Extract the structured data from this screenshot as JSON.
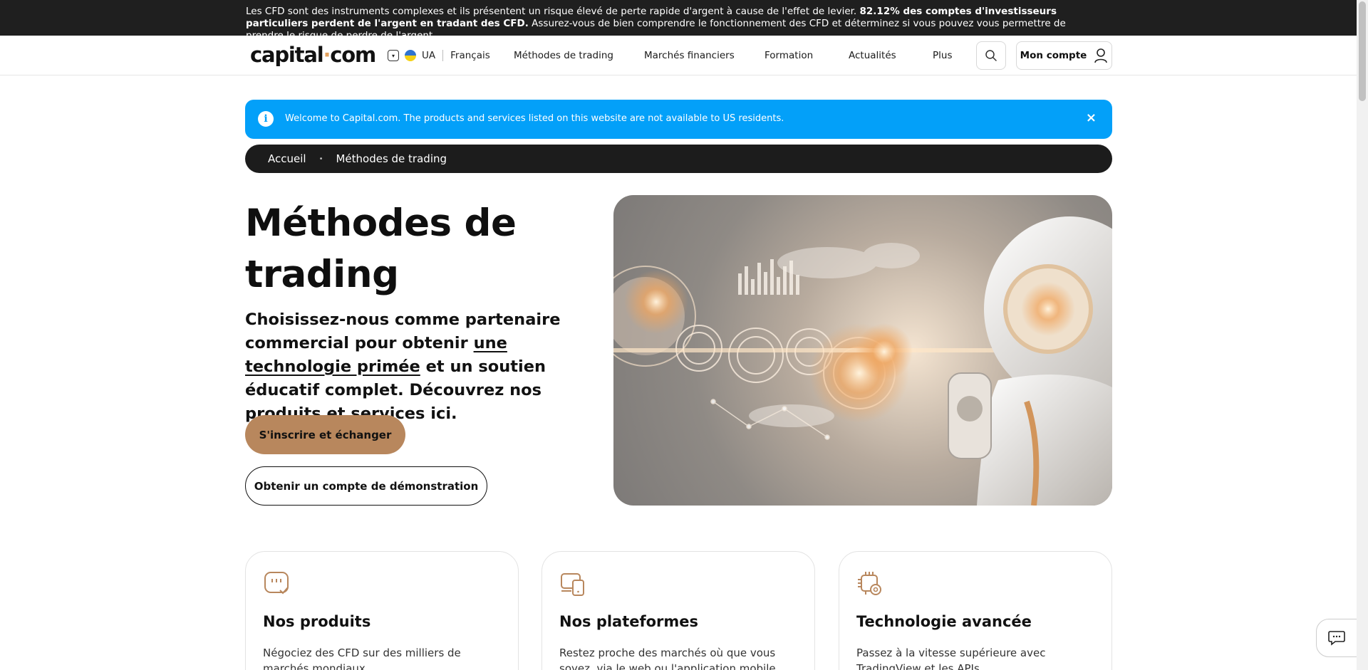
{
  "risk_banner": {
    "text_start": "Les CFD sont des instruments complexes et ils présentent un risque élevé de perte rapide d'argent à cause de l'effet de levier. ",
    "text_bold": "82.12% des comptes d'investisseurs particuliers perdent de l'argent en tradant des CFD.",
    "text_end": " Assurez-vous de bien comprendre le fonctionnement des CFD et déterminez si vous pouvez vous permettre de prendre le risque de perdre de l'argent."
  },
  "header": {
    "logo_part1": "capital",
    "logo_dot": "·",
    "logo_part2": "com",
    "country": "UA",
    "language": "Français",
    "nav": [
      "Méthodes de trading",
      "Marchés financiers",
      "Formation",
      "Actualités",
      "Plus"
    ],
    "account_label": "Mon compte"
  },
  "info_banner": {
    "icon": "i",
    "message": "Welcome to Capital.com. The products and services listed on this website are not available to US residents.",
    "close": "×"
  },
  "breadcrumb": {
    "home": "Accueil",
    "separator": "•",
    "current": "Méthodes de trading"
  },
  "hero": {
    "title": "Méthodes de trading",
    "lead_start": "Choisissez-nous comme partenaire commercial pour obtenir ",
    "lead_link": "une technologie primée",
    "lead_end": " et un soutien éducatif complet. Découvrez nos produits et services ici.",
    "primary_button": "S'inscrire et échanger",
    "secondary_button": "Obtenir un compte de démonstration"
  },
  "cards": [
    {
      "title": "Nos produits",
      "text": "Négociez des CFD sur des milliers de marchés mondiaux",
      "icon": "chat-check-icon"
    },
    {
      "title": "Nos plateformes",
      "text": "Restez proche des marchés où que vous soyez, via le web ou l'application mobile",
      "icon": "devices-icon"
    },
    {
      "title": "Technologie avancée",
      "text": "Passez à la vitesse supérieure avec TradingView et les APIs",
      "icon": "chip-gear-icon"
    }
  ],
  "colors": {
    "accent": "#b8875d",
    "info": "#03a0f9",
    "dark": "#1c1c1c"
  }
}
